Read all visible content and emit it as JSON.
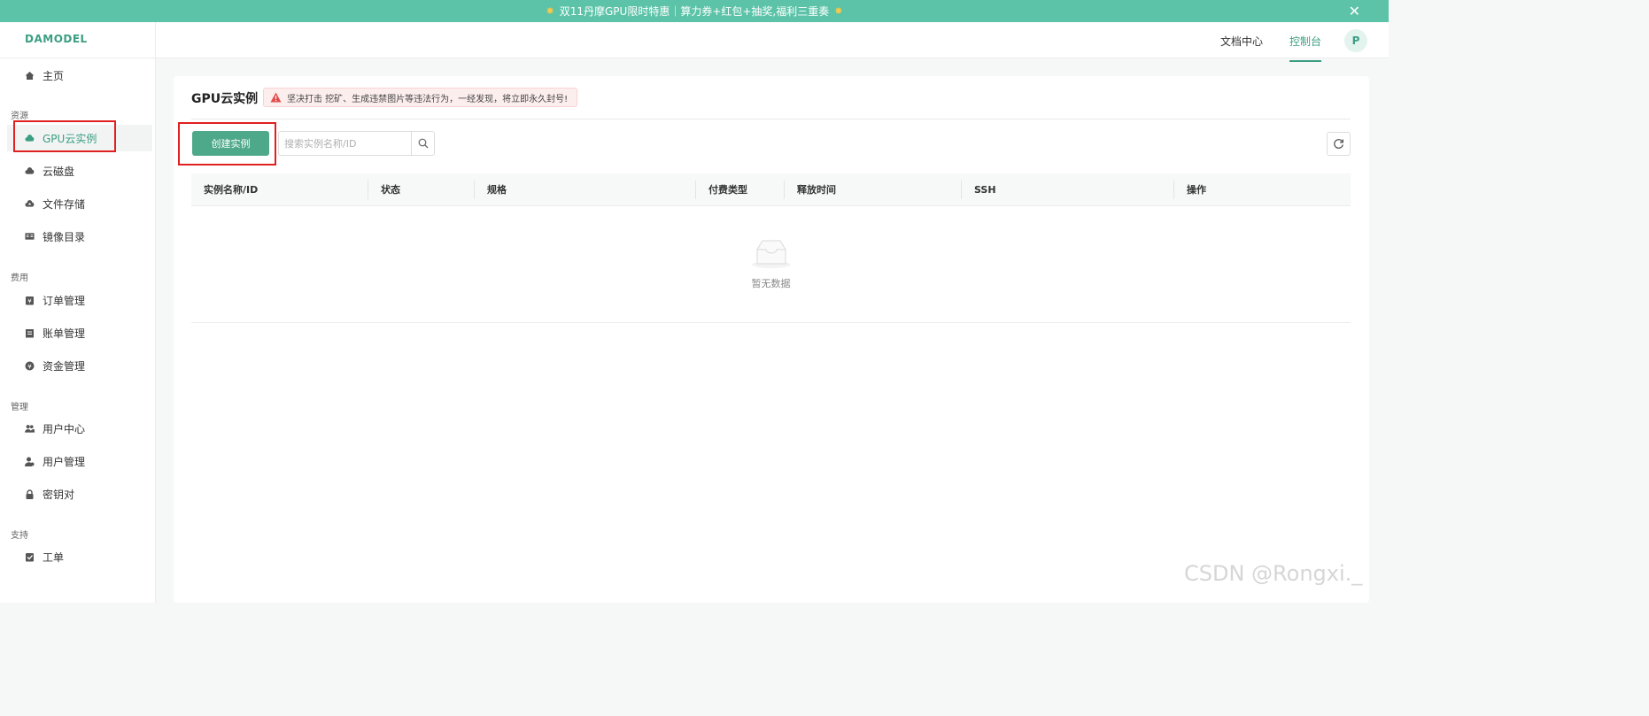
{
  "banner": {
    "text": "双11丹摩GPU限时特惠｜算力券+红包+抽奖,福利三重奏",
    "close_icon": "close-icon"
  },
  "header": {
    "logo": "DAMODEL",
    "nav": {
      "docs": "文档中心",
      "console": "控制台"
    },
    "avatar_letter": "P"
  },
  "sidebar": {
    "home": "主页",
    "groups": {
      "resources": "资源",
      "billing": "费用",
      "management": "管理",
      "support": "支持"
    },
    "items": {
      "gpu_instances": "GPU云实例",
      "cloud_disk": "云磁盘",
      "file_storage": "文件存储",
      "image_catalog": "镜像目录",
      "orders": "订单管理",
      "bills": "账单管理",
      "funds": "资金管理",
      "user_center": "用户中心",
      "user_management": "用户管理",
      "key_pairs": "密钥对",
      "tickets": "工单"
    },
    "active": "gpu_instances"
  },
  "main": {
    "title": "GPU云实例",
    "alert": "坚决打击 挖矿、生成违禁图片等违法行为，一经发现，将立即永久封号!",
    "create_button": "创建实例",
    "search": {
      "placeholder": "搜索实例名称/ID",
      "value": ""
    },
    "table": {
      "columns": [
        "实例名称/ID",
        "状态",
        "规格",
        "付费类型",
        "释放时间",
        "SSH",
        "操作"
      ],
      "rows": [],
      "empty_text": "暂无数据"
    }
  },
  "watermark": "CSDN @Rongxi._",
  "colors": {
    "brand": "#3b9e82",
    "banner_bg": "#5cc3a8",
    "button_bg": "#4ea88a",
    "alert_bg": "#fdeeee",
    "highlight_box": "#e02020"
  }
}
